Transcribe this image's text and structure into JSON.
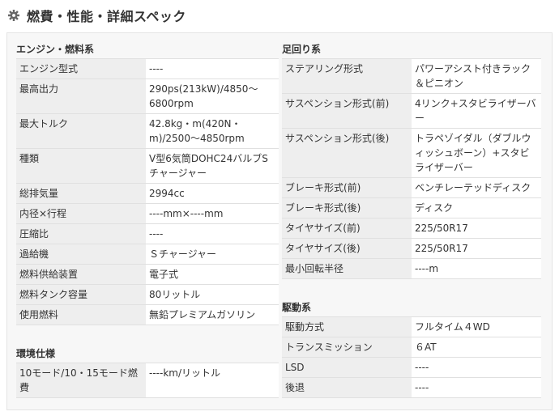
{
  "page": {
    "title": "燃費・性能・詳細スペック",
    "icon": "gear-icon"
  },
  "left": {
    "engine": {
      "title": "エンジン・燃料系",
      "rows": [
        {
          "label": "エンジン型式",
          "value": "----"
        },
        {
          "label": "最高出力",
          "value": "290ps(213kW)/4850〜6800rpm"
        },
        {
          "label": "最大トルク",
          "value": "42.8kg・m(420N・m)/2500〜4850rpm"
        },
        {
          "label": "種類",
          "value": "V型6気筒DOHC24バルブSチャージャー"
        },
        {
          "label": "総排気量",
          "value": "2994cc"
        },
        {
          "label": "内径×行程",
          "value": "----mm×----mm"
        },
        {
          "label": "圧縮比",
          "value": "----"
        },
        {
          "label": "過給機",
          "value": "Ｓチャージャー"
        },
        {
          "label": "燃料供給装置",
          "value": "電子式"
        },
        {
          "label": "燃料タンク容量",
          "value": "80リットル"
        },
        {
          "label": "使用燃料",
          "value": "無鉛プレミアムガソリン"
        }
      ]
    },
    "environment": {
      "title": "環境仕様",
      "rows": [
        {
          "label": "10モード/10・15モード燃費",
          "value": "----km/リットル"
        }
      ]
    }
  },
  "right": {
    "suspension": {
      "title": "足回り系",
      "rows": [
        {
          "label": "ステアリング形式",
          "value": "パワーアシスト付きラック＆ピニオン"
        },
        {
          "label": "サスペンション形式(前)",
          "value": "4リンク+スタビライザーバー"
        },
        {
          "label": "サスペンション形式(後)",
          "value": "トラペゾイダル（ダブルウィッシュボーン）+スタビライザーバー"
        },
        {
          "label": "ブレーキ形式(前)",
          "value": "ベンチレーテッドディスク"
        },
        {
          "label": "ブレーキ形式(後)",
          "value": "ディスク"
        },
        {
          "label": "タイヤサイズ(前)",
          "value": "225/50R17"
        },
        {
          "label": "タイヤサイズ(後)",
          "value": "225/50R17"
        },
        {
          "label": "最小回転半径",
          "value": "----m"
        }
      ]
    },
    "drive": {
      "title": "駆動系",
      "rows": [
        {
          "label": "駆動方式",
          "value": "フルタイム４WD"
        },
        {
          "label": "トランスミッション",
          "value": "６AT"
        },
        {
          "label": "LSD",
          "value": "----"
        },
        {
          "label": "後退",
          "value": "----"
        }
      ]
    }
  }
}
